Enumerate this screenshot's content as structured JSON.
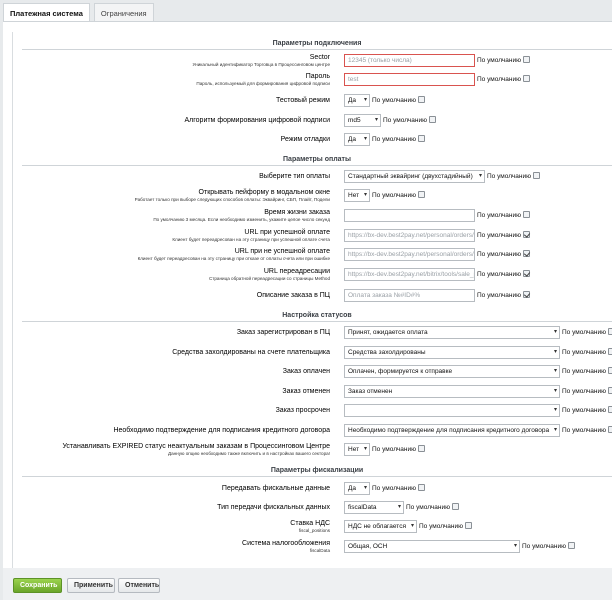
{
  "tabs": [
    {
      "label": "Платежная система"
    },
    {
      "label": "Ограничения"
    }
  ],
  "sections": {
    "connection": "Параметры подключения",
    "payment": "Параметры оплаты",
    "statuses": "Настройка статусов",
    "fiscal": "Параметры фискализации"
  },
  "default_label": "По умолчанию",
  "fields": {
    "sector": {
      "label": "Sector",
      "sub": "Уникальный идентификатор Торговца в Процессинговом центре",
      "placeholder": "12345 (только числа)"
    },
    "password": {
      "label": "Пароль",
      "sub": "Пароль, используемый для формирования цифровой подписи",
      "placeholder": "test"
    },
    "test_mode": {
      "label": "Тестовый режим",
      "value": "Да"
    },
    "sign_algo": {
      "label": "Алгоритм формирования цифровой подписи",
      "value": "md5"
    },
    "debug_mode": {
      "label": "Режим отладки",
      "value": "Да"
    },
    "pay_type": {
      "label": "Выберите тип оплаты",
      "value": "Стандартный эквайринг (двухстадийный)"
    },
    "modal": {
      "label": "Открывать пейформу в модальном окне",
      "sub": "Работает только при выборе следующих способов оплаты: Эквайринг, СБП, Плайт, Подели",
      "value": "Нет"
    },
    "order_life": {
      "label": "Время жизни заказа",
      "sub": "По умолчанию 3 месяца. Если необходимо изменить, укажите целое число секунд",
      "placeholder": ""
    },
    "success_url": {
      "label": "URL при успешной оплате",
      "sub": "Клиент будет переадресован на эту страницу при успешной оплате счета",
      "placeholder": "https://bx-dev.best2pay.net/personal/orders/"
    },
    "fail_url": {
      "label": "URL при не успешной оплате",
      "sub": "Клиент будет переадресован на эту страницу при отказе от оплаты счета или при ошибке",
      "placeholder": "https://bx-dev.best2pay.net/personal/orders/"
    },
    "redirect_url": {
      "label": "URL переадресации",
      "sub": "Страница обратной переадресации со страницы Method",
      "placeholder": "https://bx-dev.best2pay.net/bitrix/tools/sale_ps"
    },
    "description": {
      "label": "Описание заказа в ПЦ",
      "placeholder": "Оплата заказа №#ID#%"
    },
    "st_registered": {
      "label": "Заказ зарегистрирован в ПЦ",
      "value": "Принят, ожидается оплата"
    },
    "st_hold": {
      "label": "Средства захолдированы на счете плательщика",
      "value": "Средства захолдированы"
    },
    "st_paid": {
      "label": "Заказ оплачен",
      "value": "Оплачен, формируется к отправке"
    },
    "st_cancel": {
      "label": "Заказ отменен",
      "value": "Заказ отменен"
    },
    "st_overdue": {
      "label": "Заказ просрочен",
      "value": ""
    },
    "st_credit": {
      "label": "Необходимо подтверждение для подписания кредитного договора",
      "value": "Необходимо подтверждение для подписания кредитного договора"
    },
    "st_expired": {
      "label": "Устанавливать EXPIRED статус неактуальным заказам в Процессинговом Центре",
      "sub": "Данную опцию необходимо также включить и в настройках вашего сектора!",
      "value": "Нет"
    },
    "fiscal_send": {
      "label": "Передавать фискальные данные",
      "value": "Да"
    },
    "fiscal_type": {
      "label": "Тип передачи фискальных данных",
      "value": "fiscalData"
    },
    "vat": {
      "label": "Ставка НДС",
      "sub": "fiscal_positions",
      "value": "НДС не облагается"
    },
    "tax_system": {
      "label": "Система налогообложения",
      "sub": "fiscalData",
      "value": "Общая, ОСН"
    }
  },
  "buttons": {
    "save": "Сохранить",
    "apply": "Применить",
    "cancel": "Отменить"
  },
  "colors": {
    "accent_green": "#7ab83a",
    "error_border": "#d9534f"
  }
}
